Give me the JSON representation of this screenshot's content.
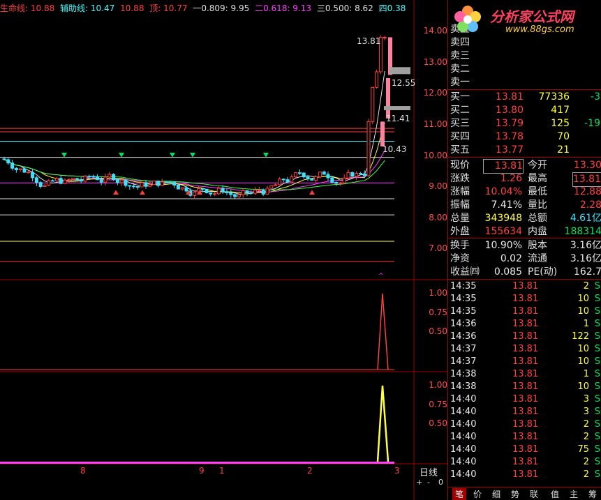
{
  "legend": {
    "life_line": "生命线: 10.88",
    "aux_line": "辅助线: 10.47",
    "aux_line2": "10.88",
    "top": "顶: 10.77",
    "fib809": "一0.809: 9.95",
    "fib618": "二0.618: 9.13",
    "fib500": "三0.500: 8.62",
    "fib4": "四0.38"
  },
  "price_axis": [
    "14.00",
    "13.00",
    "12.00",
    "11.00",
    "10.00",
    "9.00",
    "8.00",
    "7.00"
  ],
  "sub1_axis": [
    "1.00",
    "0.75",
    "0.50"
  ],
  "sub2_axis": [
    "1.00",
    "0.75",
    "0.50"
  ],
  "annotations": {
    "high": "13.81",
    "mid1": "12.55",
    "mid2": "11.41",
    "low": "10.43"
  },
  "time_axis": [
    "8",
    "9",
    "1",
    "2",
    "3"
  ],
  "period_label": "日线",
  "zoom_controls": {
    "plus": "+",
    "minus": "-",
    "zero": "0"
  },
  "logo": {
    "brand": "分析家公式网",
    "url": "www.88gs.com"
  },
  "order_book": {
    "asks": [
      {
        "label": "卖五"
      },
      {
        "label": "卖四"
      },
      {
        "label": "卖三"
      },
      {
        "label": "卖二"
      },
      {
        "label": "卖一"
      }
    ],
    "bids": [
      {
        "label": "买一",
        "price": "13.81",
        "vol": "77336",
        "chg": "-3"
      },
      {
        "label": "买二",
        "price": "13.80",
        "vol": "417",
        "chg": ""
      },
      {
        "label": "买三",
        "price": "13.79",
        "vol": "125",
        "chg": "-19"
      },
      {
        "label": "买四",
        "price": "13.78",
        "vol": "70",
        "chg": ""
      },
      {
        "label": "买五",
        "price": "13.77",
        "vol": "21",
        "chg": ""
      }
    ]
  },
  "quote": [
    {
      "l1": "现价",
      "v1": "13.81",
      "l2": "今开",
      "v2": "13.30"
    },
    {
      "l1": "涨跌",
      "v1": "1.26",
      "l2": "最高",
      "v2": "13.81"
    },
    {
      "l1": "涨幅",
      "v1": "10.04%",
      "l2": "最低",
      "v2": "12.88"
    },
    {
      "l1": "振幅",
      "v1": "7.41%",
      "l2": "量比",
      "v2": "2.28"
    },
    {
      "l1": "总量",
      "v1": "343948",
      "l2": "总额",
      "v2": "4.61亿"
    },
    {
      "l1": "外盘",
      "v1": "155634",
      "l2": "内盘",
      "v2": "188314"
    }
  ],
  "fundamentals": [
    {
      "l1": "换手",
      "v1": "10.90%",
      "l2": "股本",
      "v2": "3.16亿"
    },
    {
      "l1": "净资",
      "v1": "0.02",
      "l2": "流通",
      "v2": "3.16亿"
    },
    {
      "l1": "收益㈣",
      "v1": "0.085",
      "l2": "PE(动)",
      "v2": "162.7"
    }
  ],
  "ticks": [
    {
      "time": "14:35",
      "price": "13.81",
      "vol": "2",
      "side": "S"
    },
    {
      "time": "14:35",
      "price": "13.81",
      "vol": "10",
      "side": "S"
    },
    {
      "time": "14:35",
      "price": "13.81",
      "vol": "10",
      "side": "S"
    },
    {
      "time": "14:36",
      "price": "13.81",
      "vol": "1",
      "side": "S"
    },
    {
      "time": "14:36",
      "price": "13.81",
      "vol": "122",
      "side": "S"
    },
    {
      "time": "14:37",
      "price": "13.81",
      "vol": "10",
      "side": "S"
    },
    {
      "time": "14:37",
      "price": "13.81",
      "vol": "10",
      "side": "S"
    },
    {
      "time": "14:38",
      "price": "13.81",
      "vol": "1",
      "side": "S"
    },
    {
      "time": "14:38",
      "price": "13.81",
      "vol": "10",
      "side": "S"
    },
    {
      "time": "14:40",
      "price": "13.81",
      "vol": "3",
      "side": "S"
    },
    {
      "time": "14:40",
      "price": "13.81",
      "vol": "3",
      "side": "S"
    },
    {
      "time": "14:40",
      "price": "13.81",
      "vol": "2",
      "side": "S"
    },
    {
      "time": "14:40",
      "price": "13.81",
      "vol": "2",
      "side": "S"
    },
    {
      "time": "14:40",
      "price": "13.81",
      "vol": "75",
      "side": "S"
    },
    {
      "time": "14:40",
      "price": "13.81",
      "vol": "2",
      "side": "S"
    },
    {
      "time": "14:40",
      "price": "13.81",
      "vol": "2",
      "side": "S"
    }
  ],
  "tabs": [
    "笔",
    "价",
    "细",
    "势",
    "联",
    "值",
    "主",
    "筹"
  ],
  "colors": {
    "up": "#ff4040",
    "down": "#40e0ff",
    "border": "#a00000",
    "ma_white": "#e0e0e0",
    "ma_yellow": "#ffff40",
    "ma_magenta": "#ff40ff",
    "ma_green": "#40ff40"
  }
}
